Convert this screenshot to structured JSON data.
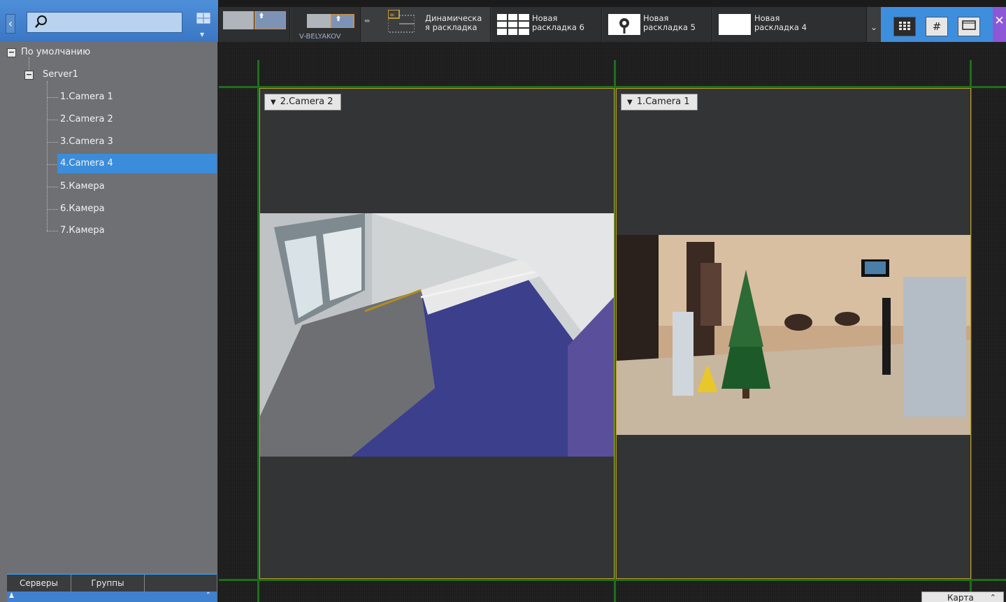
{
  "search": {
    "placeholder": "",
    "value": ""
  },
  "tree": {
    "root_label": "По умолчанию",
    "server_label": "Server1",
    "cameras": [
      "1.Camera 1",
      "2.Camera 2",
      "3.Camera 3",
      "4.Camera 4",
      "5.Камера",
      "6.Камера",
      "7.Камера"
    ],
    "selected": "4.Camera 4"
  },
  "left_tabs": {
    "servers": "Серверы",
    "groups": "Группы"
  },
  "top_tabs": [
    {
      "label": ""
    },
    {
      "label": "V-BELYAKOV"
    },
    {
      "label_line1": "Динамическа",
      "label_line2": "я раскладка"
    },
    {
      "label_line1": "Новая",
      "label_line2": "раскладка 6"
    },
    {
      "label_line1": "Новая",
      "label_line2": "раскладка 5"
    },
    {
      "label_line1": "Новая",
      "label_line2": "раскладка 4"
    }
  ],
  "cameras": [
    {
      "label": "2.Camera 2"
    },
    {
      "label": "1.Camera 1"
    }
  ],
  "map_button": "Карта",
  "colors": {
    "accent": "#3b8ddb",
    "frame": "#b89a2c",
    "grid": "#1f6e1c",
    "settings": "#8c58d8"
  },
  "icons": [
    "search-icon",
    "layout-icon",
    "grid-view-icon",
    "hash-view-icon",
    "single-view-icon",
    "settings-icon",
    "dropdown-icon"
  ]
}
